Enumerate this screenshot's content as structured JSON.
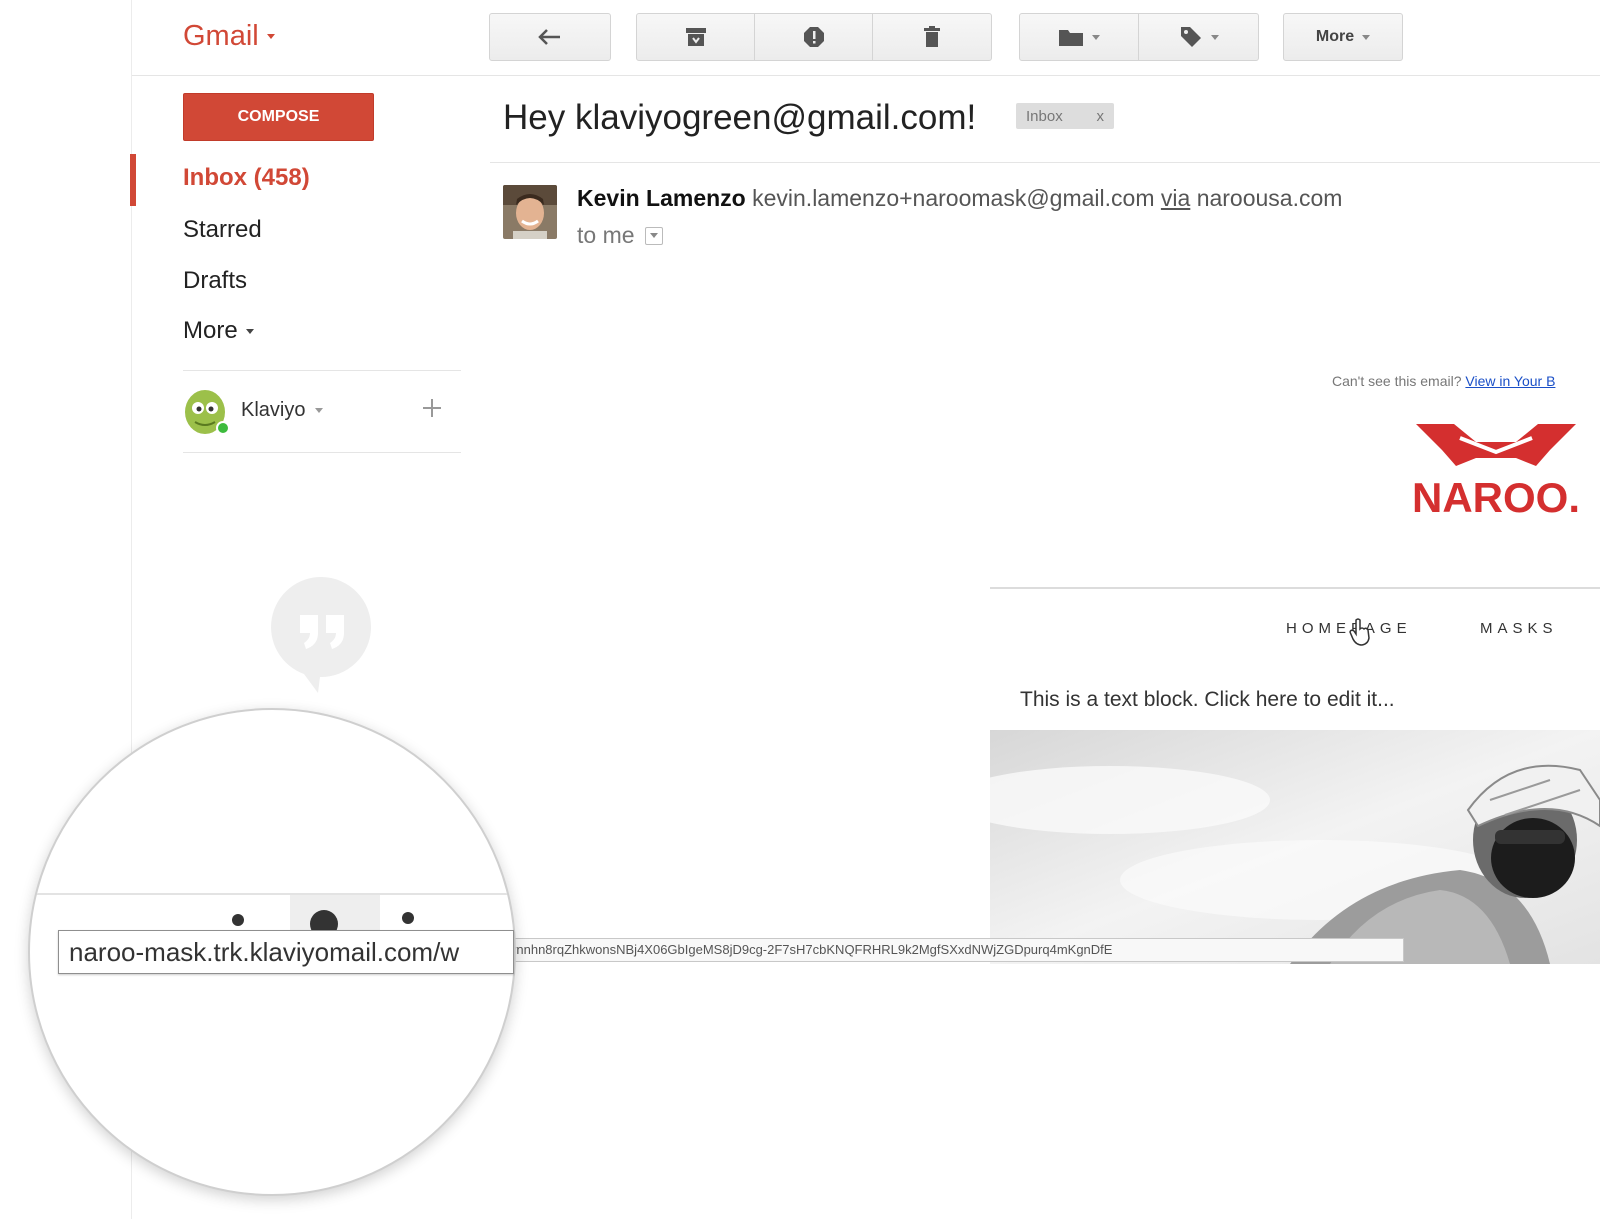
{
  "app": {
    "name": "Gmail"
  },
  "toolbar": {
    "more_label": "More"
  },
  "sidebar": {
    "compose_label": "COMPOSE",
    "items": [
      {
        "label": "Inbox (458)",
        "active": true
      },
      {
        "label": "Starred"
      },
      {
        "label": "Drafts"
      },
      {
        "label": "More"
      }
    ],
    "account": {
      "name": "Klaviyo"
    }
  },
  "email": {
    "subject": "Hey klaviyogreen@gmail.com!",
    "label": "Inbox",
    "label_remove": "x",
    "sender_name": "Kevin Lamenzo",
    "sender_email": "kevin.lamenzo+naroomask@gmail.com",
    "via_label": "via",
    "via_domain": "naroousa.com",
    "recipient": "to me"
  },
  "email_body": {
    "cant_see_text": "Can't see this email?",
    "view_link": "View in Your B",
    "logo_text": "NAROO.",
    "nav": [
      "HOMEPAGE",
      "MASKS"
    ],
    "text_block": "This is a text block. Click here to edit it..."
  },
  "status_bar": {
    "url_zoomed": "naroo-mask.trk.klaviyomail.com/w",
    "url_full": "wnnhn8rqZhkwonsNBj4X06GbIgeMS8jD9cg-2F7sH7cbKNQFRHRL9k2MgfSXxdNWjZGDpurq4mKgnDfE"
  },
  "colors": {
    "gmail_red": "#d14836",
    "link_blue": "#1a4fc7",
    "naroo_red": "#d42f2f"
  }
}
